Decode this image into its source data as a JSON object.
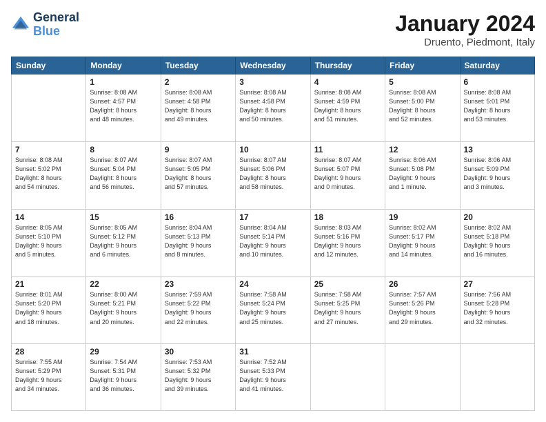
{
  "header": {
    "logo_line1": "General",
    "logo_line2": "Blue",
    "month_title": "January 2024",
    "location": "Druento, Piedmont, Italy"
  },
  "calendar": {
    "days_of_week": [
      "Sunday",
      "Monday",
      "Tuesday",
      "Wednesday",
      "Thursday",
      "Friday",
      "Saturday"
    ],
    "weeks": [
      [
        {
          "num": "",
          "lines": []
        },
        {
          "num": "1",
          "lines": [
            "Sunrise: 8:08 AM",
            "Sunset: 4:57 PM",
            "Daylight: 8 hours",
            "and 48 minutes."
          ]
        },
        {
          "num": "2",
          "lines": [
            "Sunrise: 8:08 AM",
            "Sunset: 4:58 PM",
            "Daylight: 8 hours",
            "and 49 minutes."
          ]
        },
        {
          "num": "3",
          "lines": [
            "Sunrise: 8:08 AM",
            "Sunset: 4:58 PM",
            "Daylight: 8 hours",
            "and 50 minutes."
          ]
        },
        {
          "num": "4",
          "lines": [
            "Sunrise: 8:08 AM",
            "Sunset: 4:59 PM",
            "Daylight: 8 hours",
            "and 51 minutes."
          ]
        },
        {
          "num": "5",
          "lines": [
            "Sunrise: 8:08 AM",
            "Sunset: 5:00 PM",
            "Daylight: 8 hours",
            "and 52 minutes."
          ]
        },
        {
          "num": "6",
          "lines": [
            "Sunrise: 8:08 AM",
            "Sunset: 5:01 PM",
            "Daylight: 8 hours",
            "and 53 minutes."
          ]
        }
      ],
      [
        {
          "num": "7",
          "lines": [
            "Sunrise: 8:08 AM",
            "Sunset: 5:02 PM",
            "Daylight: 8 hours",
            "and 54 minutes."
          ]
        },
        {
          "num": "8",
          "lines": [
            "Sunrise: 8:07 AM",
            "Sunset: 5:04 PM",
            "Daylight: 8 hours",
            "and 56 minutes."
          ]
        },
        {
          "num": "9",
          "lines": [
            "Sunrise: 8:07 AM",
            "Sunset: 5:05 PM",
            "Daylight: 8 hours",
            "and 57 minutes."
          ]
        },
        {
          "num": "10",
          "lines": [
            "Sunrise: 8:07 AM",
            "Sunset: 5:06 PM",
            "Daylight: 8 hours",
            "and 58 minutes."
          ]
        },
        {
          "num": "11",
          "lines": [
            "Sunrise: 8:07 AM",
            "Sunset: 5:07 PM",
            "Daylight: 9 hours",
            "and 0 minutes."
          ]
        },
        {
          "num": "12",
          "lines": [
            "Sunrise: 8:06 AM",
            "Sunset: 5:08 PM",
            "Daylight: 9 hours",
            "and 1 minute."
          ]
        },
        {
          "num": "13",
          "lines": [
            "Sunrise: 8:06 AM",
            "Sunset: 5:09 PM",
            "Daylight: 9 hours",
            "and 3 minutes."
          ]
        }
      ],
      [
        {
          "num": "14",
          "lines": [
            "Sunrise: 8:05 AM",
            "Sunset: 5:10 PM",
            "Daylight: 9 hours",
            "and 5 minutes."
          ]
        },
        {
          "num": "15",
          "lines": [
            "Sunrise: 8:05 AM",
            "Sunset: 5:12 PM",
            "Daylight: 9 hours",
            "and 6 minutes."
          ]
        },
        {
          "num": "16",
          "lines": [
            "Sunrise: 8:04 AM",
            "Sunset: 5:13 PM",
            "Daylight: 9 hours",
            "and 8 minutes."
          ]
        },
        {
          "num": "17",
          "lines": [
            "Sunrise: 8:04 AM",
            "Sunset: 5:14 PM",
            "Daylight: 9 hours",
            "and 10 minutes."
          ]
        },
        {
          "num": "18",
          "lines": [
            "Sunrise: 8:03 AM",
            "Sunset: 5:16 PM",
            "Daylight: 9 hours",
            "and 12 minutes."
          ]
        },
        {
          "num": "19",
          "lines": [
            "Sunrise: 8:02 AM",
            "Sunset: 5:17 PM",
            "Daylight: 9 hours",
            "and 14 minutes."
          ]
        },
        {
          "num": "20",
          "lines": [
            "Sunrise: 8:02 AM",
            "Sunset: 5:18 PM",
            "Daylight: 9 hours",
            "and 16 minutes."
          ]
        }
      ],
      [
        {
          "num": "21",
          "lines": [
            "Sunrise: 8:01 AM",
            "Sunset: 5:20 PM",
            "Daylight: 9 hours",
            "and 18 minutes."
          ]
        },
        {
          "num": "22",
          "lines": [
            "Sunrise: 8:00 AM",
            "Sunset: 5:21 PM",
            "Daylight: 9 hours",
            "and 20 minutes."
          ]
        },
        {
          "num": "23",
          "lines": [
            "Sunrise: 7:59 AM",
            "Sunset: 5:22 PM",
            "Daylight: 9 hours",
            "and 22 minutes."
          ]
        },
        {
          "num": "24",
          "lines": [
            "Sunrise: 7:58 AM",
            "Sunset: 5:24 PM",
            "Daylight: 9 hours",
            "and 25 minutes."
          ]
        },
        {
          "num": "25",
          "lines": [
            "Sunrise: 7:58 AM",
            "Sunset: 5:25 PM",
            "Daylight: 9 hours",
            "and 27 minutes."
          ]
        },
        {
          "num": "26",
          "lines": [
            "Sunrise: 7:57 AM",
            "Sunset: 5:26 PM",
            "Daylight: 9 hours",
            "and 29 minutes."
          ]
        },
        {
          "num": "27",
          "lines": [
            "Sunrise: 7:56 AM",
            "Sunset: 5:28 PM",
            "Daylight: 9 hours",
            "and 32 minutes."
          ]
        }
      ],
      [
        {
          "num": "28",
          "lines": [
            "Sunrise: 7:55 AM",
            "Sunset: 5:29 PM",
            "Daylight: 9 hours",
            "and 34 minutes."
          ]
        },
        {
          "num": "29",
          "lines": [
            "Sunrise: 7:54 AM",
            "Sunset: 5:31 PM",
            "Daylight: 9 hours",
            "and 36 minutes."
          ]
        },
        {
          "num": "30",
          "lines": [
            "Sunrise: 7:53 AM",
            "Sunset: 5:32 PM",
            "Daylight: 9 hours",
            "and 39 minutes."
          ]
        },
        {
          "num": "31",
          "lines": [
            "Sunrise: 7:52 AM",
            "Sunset: 5:33 PM",
            "Daylight: 9 hours",
            "and 41 minutes."
          ]
        },
        {
          "num": "",
          "lines": []
        },
        {
          "num": "",
          "lines": []
        },
        {
          "num": "",
          "lines": []
        }
      ]
    ]
  }
}
